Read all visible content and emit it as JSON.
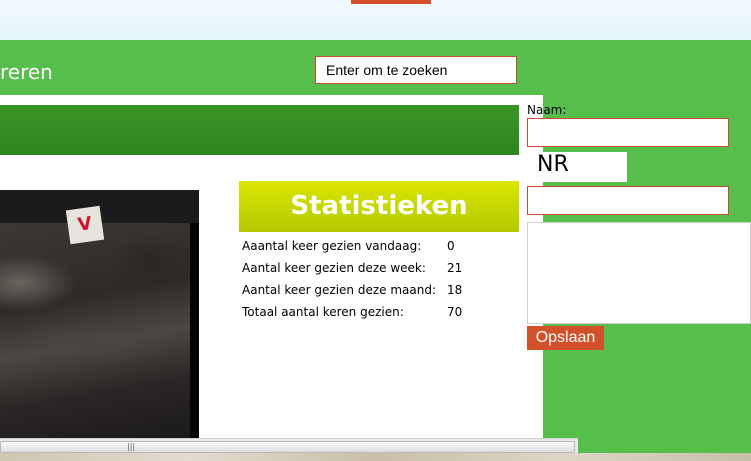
{
  "header": {
    "title_fragment": "reren"
  },
  "search": {
    "placeholder": "Enter om te zoeken"
  },
  "stats": {
    "heading": "Statistieken",
    "rows": [
      {
        "label": "Aaantal keer gezien vandaag:",
        "value": "0"
      },
      {
        "label": "Aantal keer gezien deze week:",
        "value": "21"
      },
      {
        "label": "Aantal keer gezien deze maand:",
        "value": "18"
      },
      {
        "label": "Totaal aantal keren gezien:",
        "value": "70"
      }
    ]
  },
  "comment_form": {
    "name_label": "Naam:",
    "name_value": "",
    "captcha_text": "NR",
    "captcha_value": "",
    "comment_value": "",
    "save_label": "Opslaan"
  },
  "video": {
    "logo_letter": "V"
  },
  "scrollbar": {
    "grip": "|||"
  },
  "colors": {
    "accent_green": "#56bf4b",
    "nav_green": "#3a9526",
    "stats_header": "#c8d800",
    "button_red": "#d2512b",
    "input_border": "#c74a32"
  }
}
